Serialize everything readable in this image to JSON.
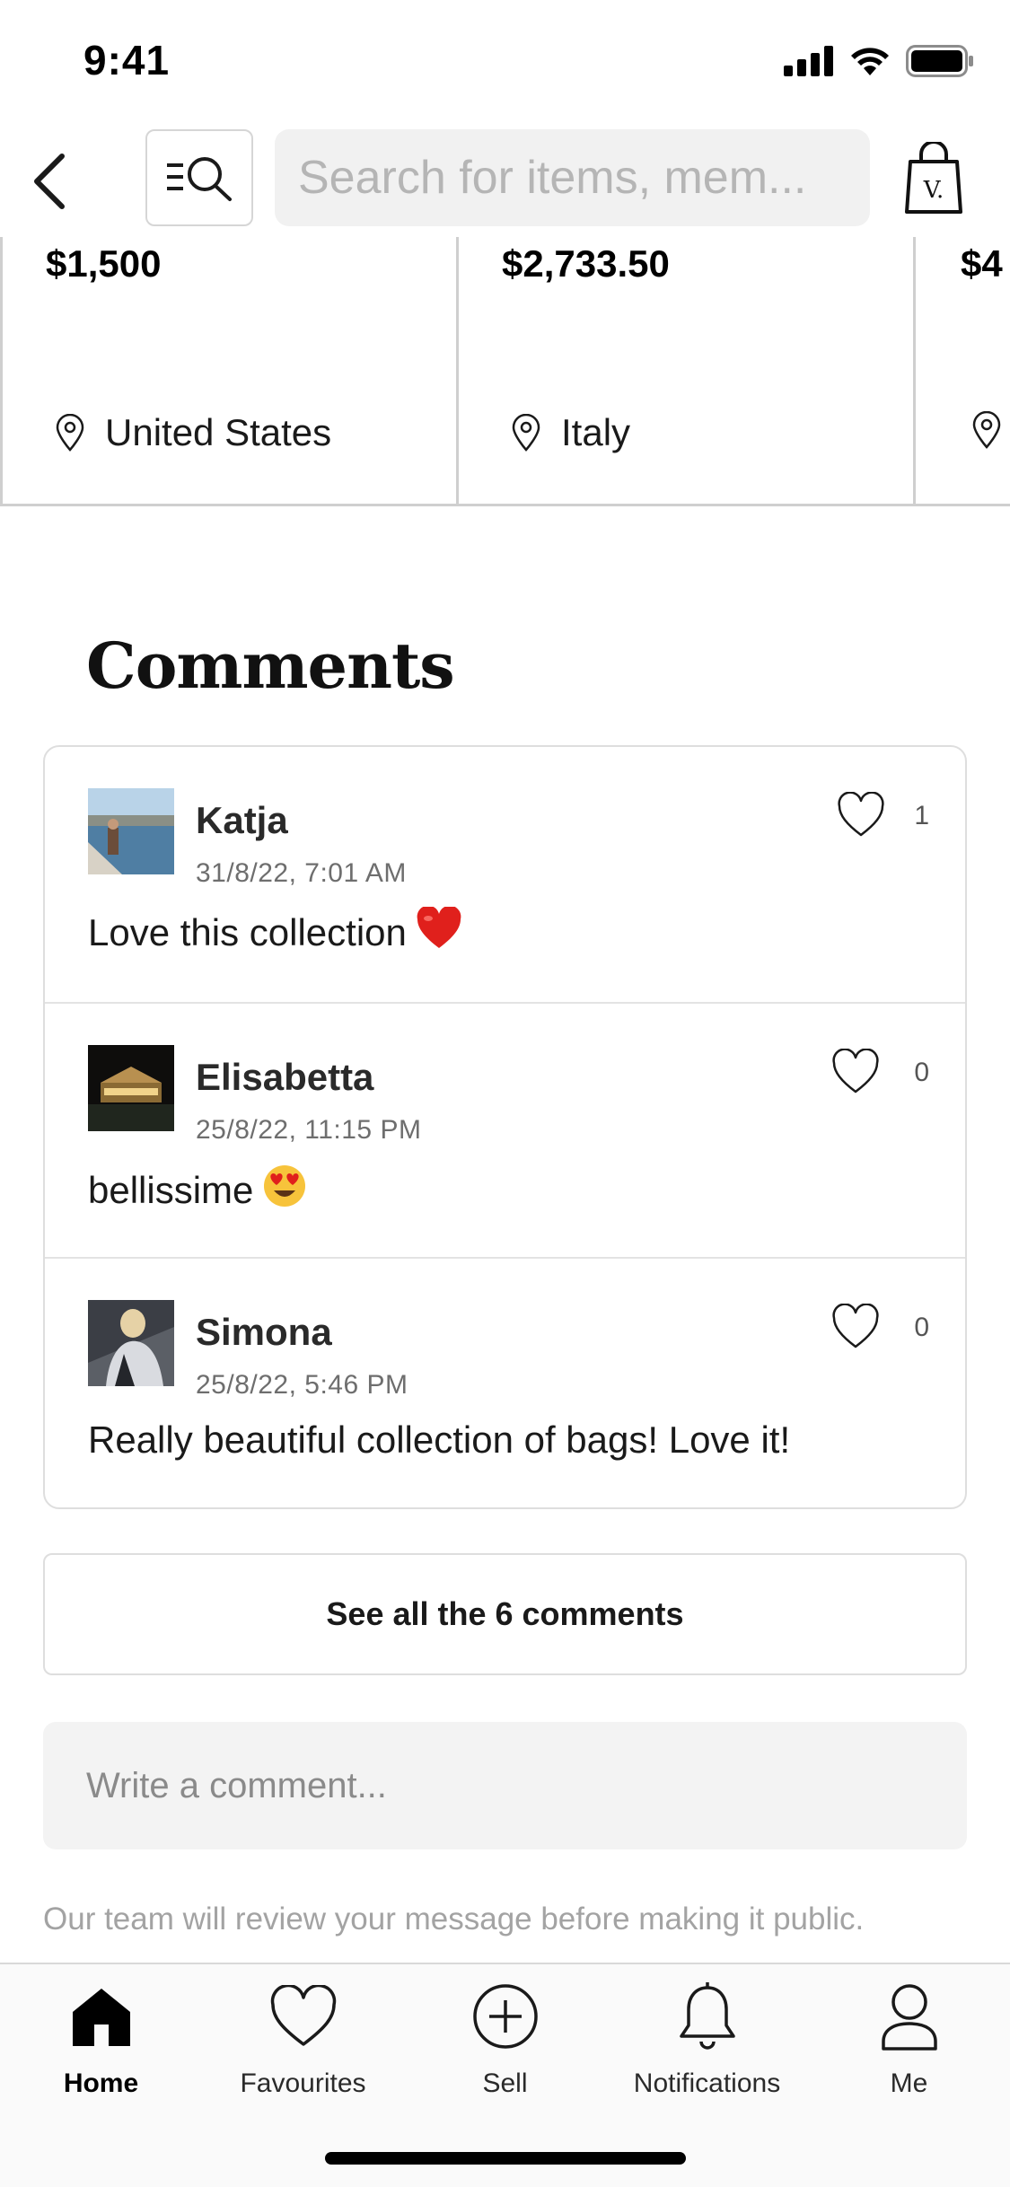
{
  "status_bar": {
    "time": "9:41",
    "icons": [
      "signal-icon",
      "wifi-icon",
      "battery-icon"
    ]
  },
  "header": {
    "back_icon": "chevron-left-icon",
    "filter_icon": "filter-search-icon",
    "search_placeholder": "Search for items, mem...",
    "bag_icon": "shopping-bag-icon",
    "bag_letter": "V."
  },
  "products": [
    {
      "price": "$1,500",
      "location": "United States"
    },
    {
      "price": "$2,733.50",
      "location": "Italy"
    },
    {
      "price": "$4",
      "location": ""
    }
  ],
  "comments": {
    "title": "Comments",
    "items": [
      {
        "name": "Katja",
        "date": "31/8/22, 7:01 AM",
        "text": "Love this collection",
        "emoji": "❤️",
        "likes": "1"
      },
      {
        "name": "Elisabetta",
        "date": "25/8/22, 11:15 PM",
        "text": "bellissime",
        "emoji": "😍",
        "likes": "0"
      },
      {
        "name": "Simona",
        "date": "25/8/22, 5:46 PM",
        "text": "Really beautiful collection of bags! Love it!",
        "emoji": "",
        "likes": "0"
      }
    ],
    "see_all_label": "See all the 6 comments",
    "write_placeholder": "Write a comment...",
    "review_note": "Our team will review your message before making it public."
  },
  "tab_bar": {
    "active": "Home",
    "tabs": [
      {
        "label": "Home",
        "icon": "home-icon"
      },
      {
        "label": "Favourites",
        "icon": "heart-icon"
      },
      {
        "label": "Sell",
        "icon": "plus-circle-icon"
      },
      {
        "label": "Notifications",
        "icon": "bell-icon"
      },
      {
        "label": "Me",
        "icon": "user-icon"
      }
    ]
  },
  "colors": {
    "text": "#1a1a1a",
    "muted": "#6e6e6e",
    "border": "#dedede",
    "input_bg": "#f3f3f3",
    "heart_emoji": "#e02020"
  }
}
